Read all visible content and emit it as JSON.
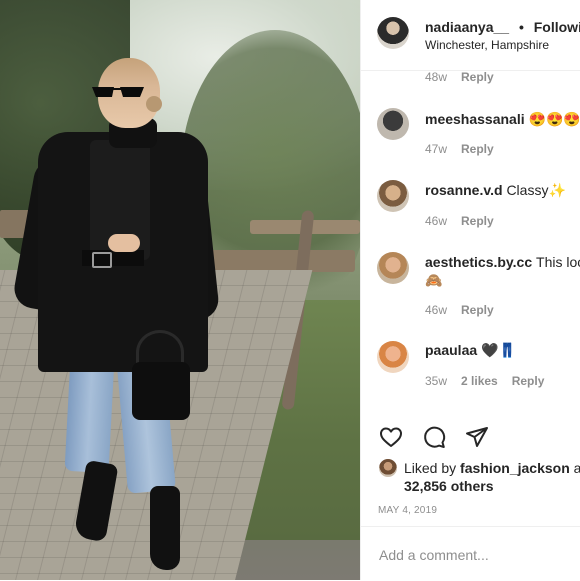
{
  "post": {
    "username": "nadiaanya__",
    "separator": "•",
    "follow_label": "Following",
    "location": "Winchester, Hampshire"
  },
  "comments": [
    {
      "meta_time": "48w",
      "reply": "Reply"
    },
    {
      "username": "meeshassanali",
      "text": "😍😍😍",
      "time": "47w",
      "reply": "Reply"
    },
    {
      "username": "rosanne.v.d",
      "text": "Classy✨",
      "time": "46w",
      "reply": "Reply"
    },
    {
      "username": "aesthetics.by.cc",
      "text": "This loo",
      "text2": "🙈",
      "time": "46w",
      "reply": "Reply"
    },
    {
      "username": "paaulaa",
      "text": "🖤👖",
      "time": "35w",
      "likes": "2 likes",
      "reply": "Reply"
    }
  ],
  "likes": {
    "prefix": "Liked by",
    "user": "fashion_jackson",
    "suffix": "an",
    "others": "32,856 others"
  },
  "date": "MAY 4, 2019",
  "add_comment": {
    "placeholder": "Add a comment..."
  },
  "icons": {
    "like": "heart-icon",
    "comment": "comment-icon",
    "share": "share-icon"
  }
}
